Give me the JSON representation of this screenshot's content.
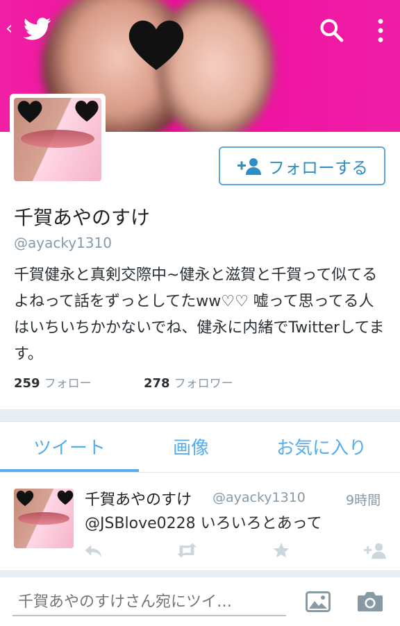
{
  "header": {
    "back_icon": "chevron-left-icon",
    "bird_icon": "twitter-bird-icon",
    "search_icon": "search-icon",
    "more_icon": "overflow-menu-icon",
    "banner_colors": [
      "#f11fa6",
      "#ee0c9c"
    ]
  },
  "profile": {
    "follow_button_label": "フォローする",
    "name": "千賀あやのすけ",
    "handle": "@ayacky1310",
    "bio": "千賀健永と真剣交際中~健永と滋賀と千賀って似てるよねって話をずっとしてたww♡♡  嘘って思ってる人はいちいちかかないでね、健永に内緒でTwitterしてます。",
    "following_count": "259",
    "following_label": "フォロー",
    "followers_count": "278",
    "followers_label": "フォロワー"
  },
  "tabs": [
    {
      "label": "ツイート",
      "active": true
    },
    {
      "label": "画像",
      "active": false
    },
    {
      "label": "お気に入り",
      "active": false
    }
  ],
  "tweet": {
    "name": "千賀あやのすけ",
    "handle": "@ayacky1310",
    "time": "9時間",
    "mention": "@JSBlove0228",
    "text": "いろいろとあって"
  },
  "compose": {
    "placeholder": "千賀あやのすけさん宛にツイ…"
  },
  "accent_color": "#55acee"
}
